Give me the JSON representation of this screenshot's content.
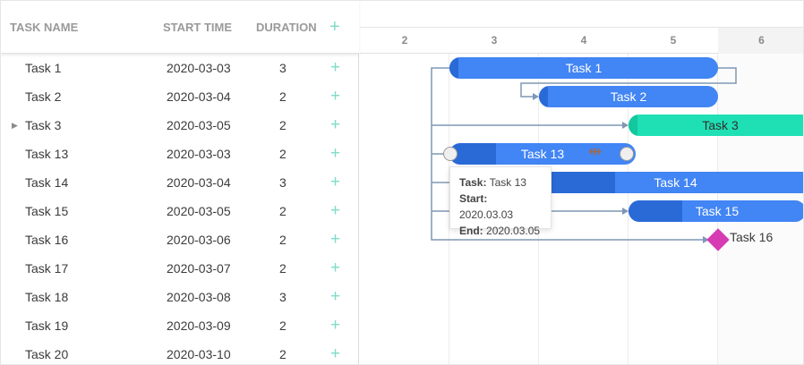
{
  "columns": {
    "name": "TASK NAME",
    "start": "START TIME",
    "duration": "DURATION",
    "add": "+"
  },
  "tasks": [
    {
      "name": "Task 1",
      "start": "2020-03-03",
      "duration": "3",
      "add": "+"
    },
    {
      "name": "Task 2",
      "start": "2020-03-04",
      "duration": "2",
      "add": "+"
    },
    {
      "name": "Task 3",
      "start": "2020-03-05",
      "duration": "2",
      "add": "+",
      "toggle": "▶"
    },
    {
      "name": "Task 13",
      "start": "2020-03-03",
      "duration": "2",
      "add": "+"
    },
    {
      "name": "Task 14",
      "start": "2020-03-04",
      "duration": "3",
      "add": "+"
    },
    {
      "name": "Task 15",
      "start": "2020-03-05",
      "duration": "2",
      "add": "+"
    },
    {
      "name": "Task 16",
      "start": "2020-03-06",
      "duration": "2",
      "add": "+"
    },
    {
      "name": "Task 17",
      "start": "2020-03-07",
      "duration": "2",
      "add": "+"
    },
    {
      "name": "Task 18",
      "start": "2020-03-08",
      "duration": "3",
      "add": "+"
    },
    {
      "name": "Task 19",
      "start": "2020-03-09",
      "duration": "2",
      "add": "+"
    },
    {
      "name": "Task 20",
      "start": "2020-03-10",
      "duration": "2",
      "add": "+"
    }
  ],
  "scale": [
    "2",
    "3",
    "4",
    "5",
    "6"
  ],
  "bars": {
    "task1": "Task 1",
    "task2": "Task 2",
    "task3": "Task 3",
    "task13": "Task 13",
    "task14": "Task 14",
    "task15": "Task 15",
    "task16": "Task 16"
  },
  "tooltip": {
    "task_label": "Task:",
    "task_value": "Task 13",
    "start_label": "Start:",
    "start_value": "2020.03.03",
    "end_label": "End:",
    "end_value": "2020.03.05"
  },
  "icons": {
    "drag": "⇹"
  },
  "colors": {
    "task_bar": "#4285f4",
    "task_progress": "#2a6ad6",
    "project_bar": "#1fe0b4",
    "milestone": "#d63bb3",
    "add_icon": "#7fdcc9",
    "link": "#7f97b4"
  }
}
